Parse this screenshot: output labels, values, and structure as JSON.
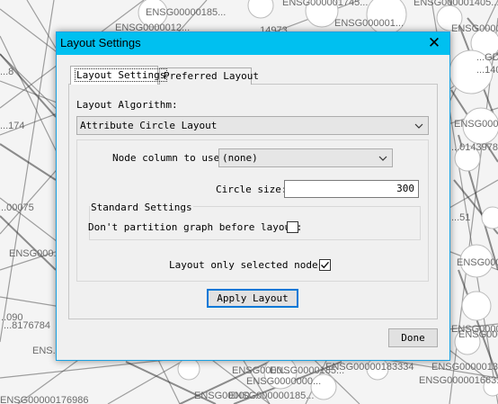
{
  "background": {
    "labels": [
      "ENSG00000185...",
      "ENSG000001745...",
      "ENSG000001405...",
      "ENSG000001...",
      "ENSG0000012...",
      "...14973",
      "ENSG0000012...",
      "...8",
      "...GD",
      "...1405",
      "...00075",
      "ENSG000...",
      "ENSG0000...",
      "...0143978",
      "...51",
      "ENSG000...",
      "...174",
      "ENSG0000016...",
      "...090",
      "...8176784",
      "ENS...",
      "ENSG0000016...",
      "ENSG0000...",
      "ENSG0000185...",
      "ENSG0000000...",
      "ENSG00000176986",
      "ENSG00000...",
      "ENSG000000185...",
      "ENSG00000183334",
      "ENSG0000013...",
      "ENSG000001663..."
    ]
  },
  "dialog": {
    "title": "Layout Settings",
    "close_glyph": "✕",
    "tabs": [
      {
        "label": "Layout Settings",
        "selected": true
      },
      {
        "label": "Preferred Layout",
        "selected": false
      }
    ],
    "algorithm_label": "Layout Algorithm:",
    "algorithm_value": "Attribute Circle Layout",
    "node_column_label": "Node column to use:",
    "node_column_value": "(none)",
    "circle_size_label": "Circle size:",
    "circle_size_value": "300",
    "standard_settings_title": "Standard Settings",
    "no_partition_label": "Don't partition graph before layout:",
    "no_partition_checked": false,
    "selected_only_label": "Layout only selected nodes:",
    "selected_only_checked": true,
    "apply_label": "Apply Layout",
    "done_label": "Done"
  }
}
